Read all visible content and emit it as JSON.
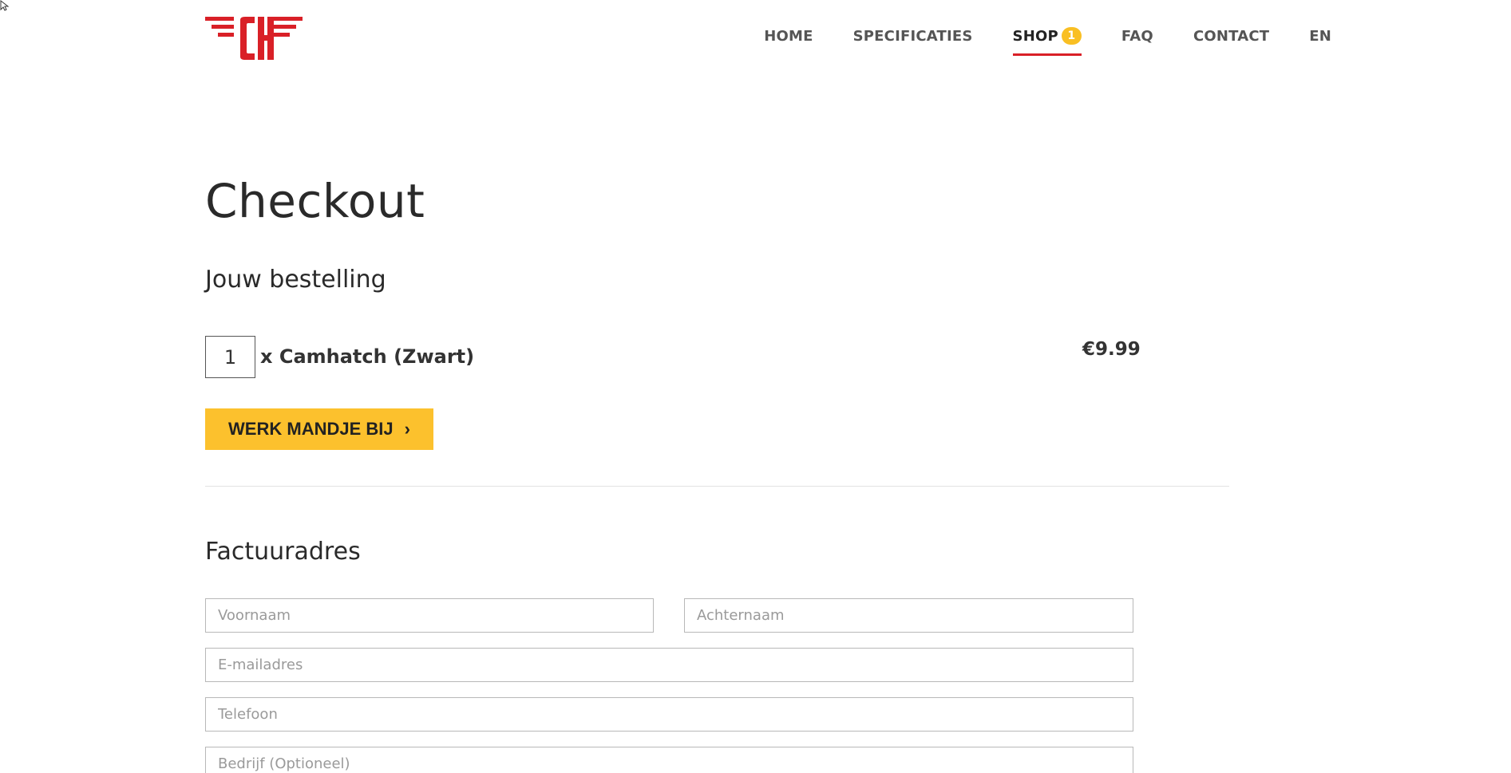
{
  "nav": {
    "items": [
      {
        "label": "HOME"
      },
      {
        "label": "SPECIFICATIES"
      },
      {
        "label": "SHOP",
        "badge": "1"
      },
      {
        "label": "FAQ"
      },
      {
        "label": "CONTACT"
      },
      {
        "label": "EN"
      }
    ]
  },
  "page": {
    "title": "Checkout",
    "order_heading": "Jouw bestelling"
  },
  "order": {
    "quantity": "1",
    "product": "x Camhatch (Zwart)",
    "price": "€9.99",
    "update_button": "WERK MANDJE BIJ",
    "update_button_icon": "chevron-right-icon"
  },
  "billing": {
    "heading": "Factuuradres",
    "first_name_placeholder": "Voornaam",
    "last_name_placeholder": "Achternaam",
    "email_placeholder": "E-mailadres",
    "phone_placeholder": "Telefoon",
    "company_placeholder": "Bedrijf (Optioneel)"
  },
  "colors": {
    "brand_red": "#d92027",
    "accent_yellow": "#fcc12d",
    "badge_yellow": "#f9bf23"
  }
}
